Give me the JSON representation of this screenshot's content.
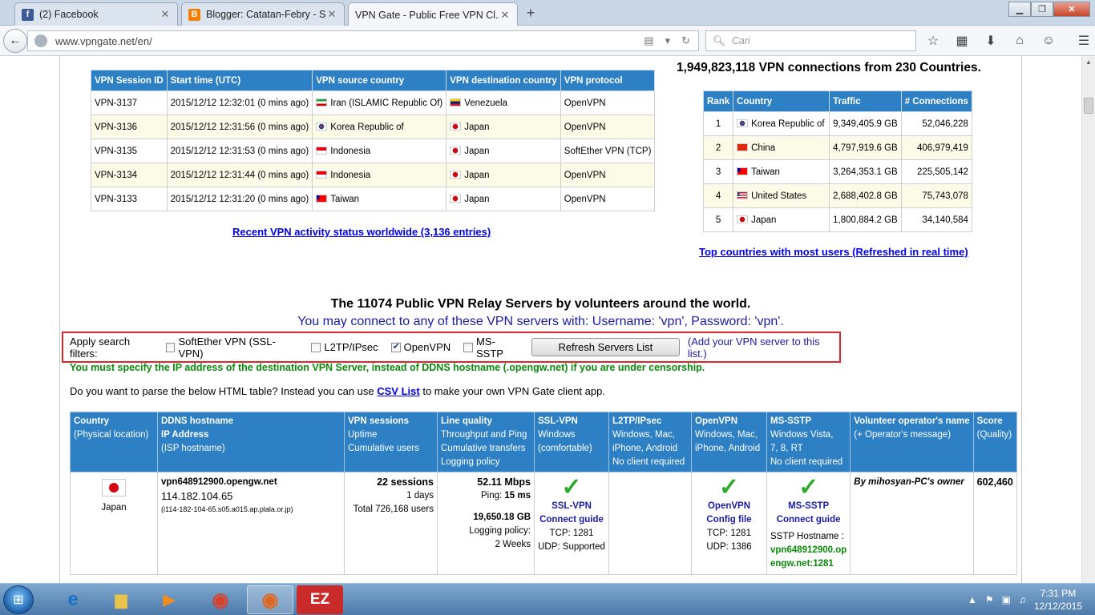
{
  "browser": {
    "tabs": [
      {
        "title": "(2) Facebook",
        "icon": "facebook-icon",
        "letter": "f",
        "color": "#3b5998"
      },
      {
        "title": "Blogger: Catatan-Febry - S...",
        "icon": "blogger-icon",
        "letter": "B",
        "color": "#f57d00"
      },
      {
        "title": "VPN Gate - Public Free VPN Cl...",
        "icon": "",
        "letter": "",
        "color": ""
      }
    ],
    "url": "www.vpngate.net/en/",
    "search_placeholder": "Cari"
  },
  "sessions_table": {
    "headers": [
      "VPN Session ID",
      "Start time (UTC)",
      "VPN source country",
      "VPN destination country",
      "VPN protocol"
    ],
    "rows": [
      {
        "id": "VPN-3137",
        "time": "2015/12/12 12:32:01 (0 mins ago)",
        "src": "Iran (ISLAMIC Republic Of)",
        "dst": "Venezuela",
        "proto": "OpenVPN"
      },
      {
        "id": "VPN-3136",
        "time": "2015/12/12 12:31:56 (0 mins ago)",
        "src": "Korea Republic of",
        "dst": "Japan",
        "proto": "OpenVPN"
      },
      {
        "id": "VPN-3135",
        "time": "2015/12/12 12:31:53 (0 mins ago)",
        "src": "Indonesia",
        "dst": "Japan",
        "proto": "SoftEther VPN (TCP)"
      },
      {
        "id": "VPN-3134",
        "time": "2015/12/12 12:31:44 (0 mins ago)",
        "src": "Indonesia",
        "dst": "Japan",
        "proto": "OpenVPN"
      },
      {
        "id": "VPN-3133",
        "time": "2015/12/12 12:31:20 (0 mins ago)",
        "src": "Taiwan",
        "dst": "Japan",
        "proto": "OpenVPN"
      }
    ],
    "link": "Recent VPN activity status worldwide (3,136 entries)"
  },
  "stats": {
    "headline": "1,949,823,118 VPN connections from 230 Countries.",
    "headers": [
      "Rank",
      "Country",
      "Traffic",
      "# Connections"
    ],
    "rows": [
      {
        "rank": "1",
        "country": "Korea Republic of",
        "traffic": "9,349,405.9 GB",
        "conn": "52,046,228"
      },
      {
        "rank": "2",
        "country": "China",
        "traffic": "4,797,919.6 GB",
        "conn": "406,979,419"
      },
      {
        "rank": "3",
        "country": "Taiwan",
        "traffic": "3,264,353.1 GB",
        "conn": "225,505,142"
      },
      {
        "rank": "4",
        "country": "United States",
        "traffic": "2,688,402.8 GB",
        "conn": "75,743,078"
      },
      {
        "rank": "5",
        "country": "Japan",
        "traffic": "1,800,884.2 GB",
        "conn": "34,140,584"
      }
    ],
    "link": "Top countries with most users (Refreshed in real time)"
  },
  "servers": {
    "title": "The 11074 Public VPN Relay Servers by volunteers around the world.",
    "subtitle": "You may connect to any of these VPN servers with: Username: 'vpn', Password: 'vpn'.",
    "filter_label": "Apply search filters:",
    "filters": [
      {
        "label": "SoftEther VPN (SSL-VPN)",
        "checked": false
      },
      {
        "label": "L2TP/IPsec",
        "checked": false
      },
      {
        "label": "OpenVPN",
        "checked": true
      },
      {
        "label": "MS-SSTP",
        "checked": false
      }
    ],
    "refresh_label": "Refresh Servers List",
    "add_link": "(Add your VPN server to this list.)",
    "warning": "You must specify the IP address of the destination VPN Server, instead of DDNS hostname (.opengw.net) if you are under censorship.",
    "parse_pre": "Do you want to parse the below HTML table? Instead you can use ",
    "parse_link": "CSV List",
    "parse_post": " to make your own VPN Gate client app.",
    "headers": [
      {
        "title": "Country",
        "lines": [
          "(Physical location)"
        ]
      },
      {
        "title": "DDNS hostname",
        "lines": [
          "IP Address",
          "(ISP hostname)"
        ]
      },
      {
        "title": "VPN sessions",
        "lines": [
          "Uptime",
          "Cumulative users"
        ]
      },
      {
        "title": "Line quality",
        "lines": [
          "Throughput and Ping",
          "Cumulative transfers",
          "Logging policy"
        ]
      },
      {
        "title": "SSL-VPN",
        "lines": [
          "Windows",
          "(comfortable)"
        ]
      },
      {
        "title": "L2TP/IPsec",
        "lines": [
          "Windows, Mac,",
          "iPhone, Android",
          "No client required"
        ]
      },
      {
        "title": "OpenVPN",
        "lines": [
          "Windows, Mac,",
          "iPhone, Android"
        ]
      },
      {
        "title": "MS-SSTP",
        "lines": [
          "Windows Vista,",
          "7, 8, RT",
          "No client required"
        ]
      },
      {
        "title": "Volunteer operator's name",
        "lines": [
          "(+ Operator's message)"
        ]
      },
      {
        "title": "Score",
        "lines": [
          "(Quality)"
        ]
      }
    ],
    "row": {
      "country": "Japan",
      "hostname": "vpn648912900.opengw.net",
      "ip": "114.182.104.65",
      "isp": "(i114-182-104-65.s05.a015.ap.plala.or.jp)",
      "sessions": "22 sessions",
      "uptime": "1 days",
      "total_users": "Total 726,168 users",
      "throughput": "52.11 Mbps",
      "ping_label": "Ping: ",
      "ping": "15 ms",
      "transfer": "19,650.18 GB",
      "logging_label": "Logging policy:",
      "logging": "2 Weeks",
      "ssl_link1": "SSL-VPN",
      "ssl_link2": "Connect guide",
      "ssl_tcp": "TCP: 1281",
      "ssl_udp": "UDP: Supported",
      "ovpn_link1": "OpenVPN",
      "ovpn_link2": "Config file",
      "ovpn_tcp": "TCP: 1281",
      "ovpn_udp": "UDP: 1386",
      "sstp_link1": "MS-SSTP",
      "sstp_link2": "Connect guide",
      "sstp_host_label": "SSTP Hostname :",
      "sstp_host1": "vpn648912900.op",
      "sstp_host2": "engw.net:1281",
      "operator": "By mihosyan-PC's owner",
      "score": "602,460"
    }
  },
  "taskbar": {
    "time": "7:31 PM",
    "date": "12/12/2015"
  }
}
